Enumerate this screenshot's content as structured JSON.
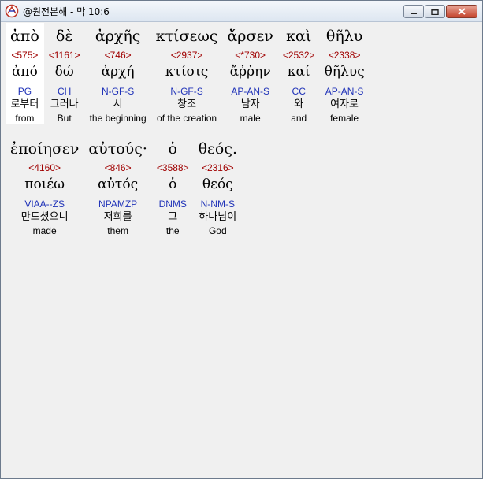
{
  "window": {
    "title": "@원전본해 - 막 10:6"
  },
  "verse": {
    "line1": [
      {
        "greek": "ἀπὸ",
        "strong": "<575>",
        "lemma": "ἀπό",
        "parsing": "PG",
        "korean": "로부터",
        "english": "from",
        "selected": true
      },
      {
        "greek": "δὲ",
        "strong": "<1161>",
        "lemma": "δώ",
        "parsing": "CH",
        "korean": "그러나",
        "english": "But"
      },
      {
        "greek": "ἀρχῆς",
        "strong": "<746>",
        "lemma": "ἀρχή",
        "parsing": "N-GF-S",
        "korean": "시",
        "english": "the beginning"
      },
      {
        "greek": "κτίσεως",
        "strong": "<2937>",
        "lemma": "κτίσις",
        "parsing": "N-GF-S",
        "korean": "창조",
        "english": "of the creation"
      },
      {
        "greek": "ἄρσεν",
        "strong": "<*730>",
        "lemma": "ἄῤῥην",
        "parsing": "AP-AN-S",
        "korean": "남자",
        "english": "male"
      },
      {
        "greek": "καὶ",
        "strong": "<2532>",
        "lemma": "καί",
        "parsing": "CC",
        "korean": "와",
        "english": "and"
      },
      {
        "greek": "θῆλυ",
        "strong": "<2338>",
        "lemma": "θῆλυς",
        "parsing": "AP-AN-S",
        "korean": "여자로",
        "english": "female"
      }
    ],
    "line2": [
      {
        "greek": "ἐποίησεν",
        "strong": "<4160>",
        "lemma": "ποιέω",
        "parsing": "VIAA--ZS",
        "korean": "만드셨으니",
        "english": "made"
      },
      {
        "greek": "αὐτούς·",
        "strong": "<846>",
        "lemma": "αὐτός",
        "parsing": "NPAMZP",
        "korean": "저희를",
        "english": "them"
      },
      {
        "greek": "ὁ",
        "strong": "<3588>",
        "lemma": "ὁ",
        "parsing": "DNMS",
        "korean": "그",
        "english": "the"
      },
      {
        "greek": "θεός.",
        "strong": "<2316>",
        "lemma": "θεός",
        "parsing": "N-NM-S",
        "korean": "하나님이",
        "english": "God"
      }
    ]
  },
  "colors": {
    "strong": "#a00000",
    "parsing": "#1f32b8",
    "background": "#f0f0f0"
  }
}
